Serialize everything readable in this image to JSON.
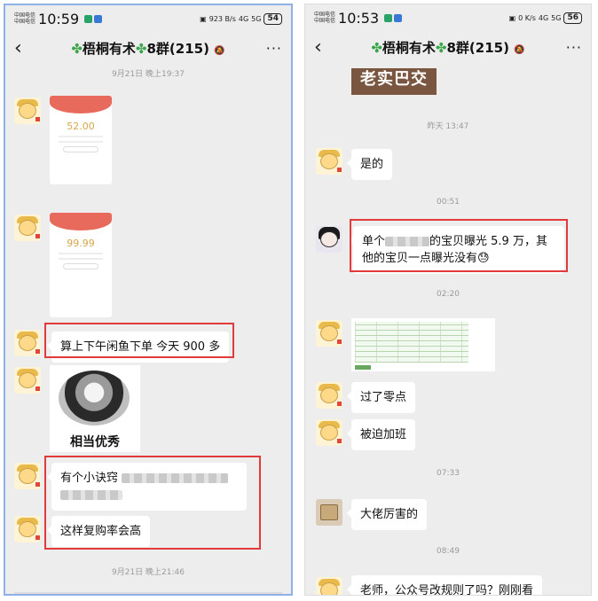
{
  "left": {
    "status": {
      "carrier1": "中国电信",
      "carrier2": "中国电信",
      "time": "10:59",
      "net": "923 B/s",
      "signal_a": "4G",
      "signal_b": "5G",
      "battery": "54"
    },
    "title": "梧桐有术",
    "title_suffix": "8群(215)",
    "messages": {
      "ts_top": "9月21日 晚上19:37",
      "redpacket1": "52.00",
      "redpacket2": "99.99",
      "msg_order": "算上下午闲鱼下单 今天 900 多",
      "meme_caption": "相当优秀",
      "msg_tip": "有个小诀窍",
      "msg_repurchase": "这样复购率会高",
      "ts_bottom": "9月21日 晚上21:46"
    }
  },
  "right": {
    "status": {
      "carrier1": "中国电信",
      "carrier2": "中国电信",
      "time": "10:53",
      "net": "0 K/s",
      "signal_a": "4G",
      "signal_b": "5G",
      "battery": "56"
    },
    "title": "梧桐有术",
    "title_suffix": "8群(215)",
    "messages": {
      "photo_text": "老实巴交",
      "ts_yesterday": "昨天 13:47",
      "msg_yes": "是的",
      "ts_0051": "00:51",
      "msg_exposure_a": "单个",
      "msg_exposure_b": "的宝贝曝光 5.9 万，其他的宝贝一点曝光没有😓",
      "ts_0220": "02:20",
      "msg_midnight": "过了零点",
      "msg_overtime": "被迫加班",
      "ts_0733": "07:33",
      "msg_boss": "大佬厉害的",
      "ts_0849": "08:49",
      "msg_teacher": "老师，公众号改规则了吗？刚刚看"
    }
  }
}
